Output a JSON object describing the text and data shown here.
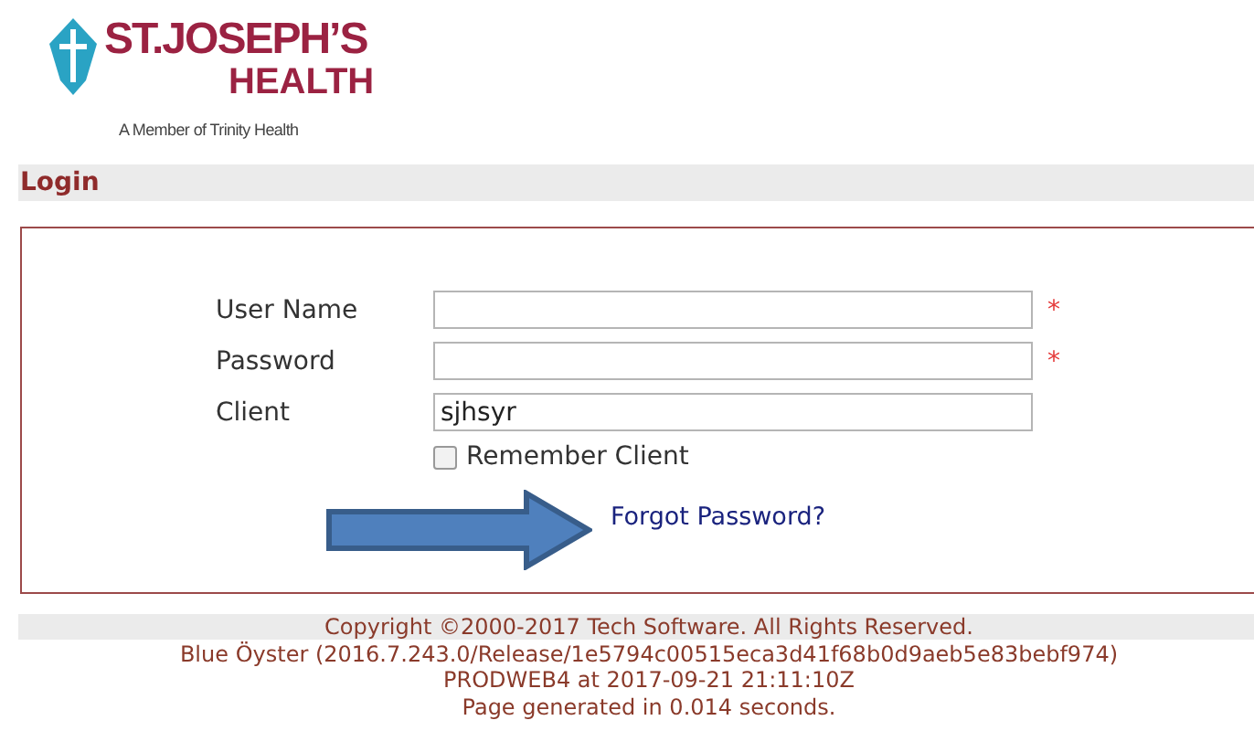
{
  "logo": {
    "name": "ST.JOSEPH’S",
    "sub": "HEALTH",
    "tagline": "A Member of Trinity Health"
  },
  "section_title": "Login",
  "fields": [
    {
      "label": "User Name",
      "required": true
    },
    {
      "label": "Password",
      "required": true
    },
    {
      "label": "Client",
      "value": "sjhsyr",
      "required": false
    }
  ],
  "required_mark": "*",
  "remember": {
    "label": "Remember Client",
    "checked": false
  },
  "forgot_link": "Forgot Password?",
  "footer": [
    "Copyright ©2000-2017 Tech Software. All Rights Reserved.",
    "Blue Öyster (2016.7.243.0/Release/1e5794c00515eca3d41f68b0d9aeb5e83bebf974)",
    "PRODWEB4 at 2017-09-21 21:11:10Z",
    "Page generated in 0.014 seconds."
  ]
}
